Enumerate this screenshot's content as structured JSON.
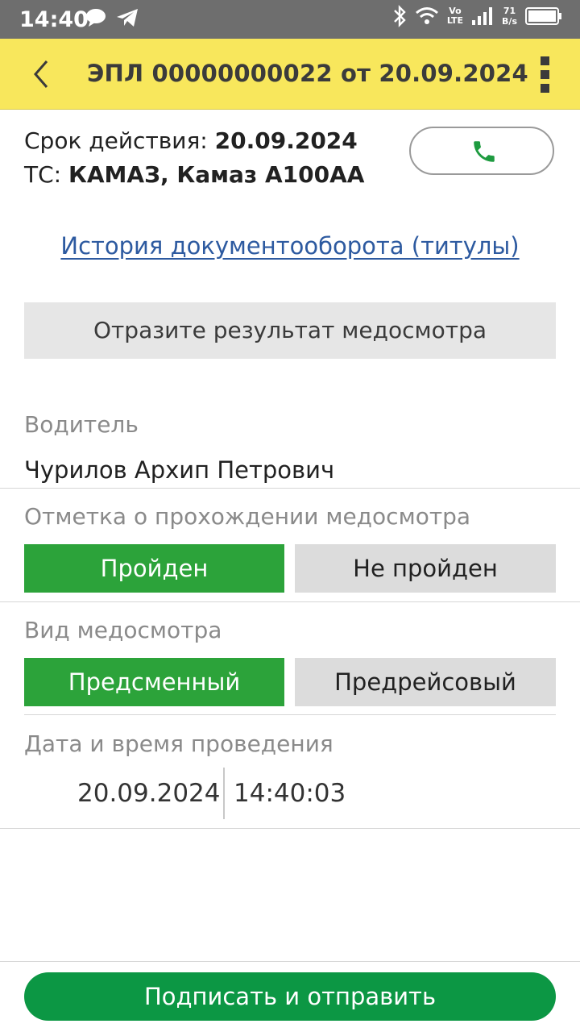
{
  "status_bar": {
    "time": "14:40",
    "network_label_top": "Vo",
    "network_label_bottom": "LTE",
    "speed_value": "71",
    "speed_unit": "B/s"
  },
  "app_bar": {
    "title": "ЭПЛ 00000000022 от 20.09.2024",
    "accent_color": "#f8e75c"
  },
  "header": {
    "validity_label": "Срок действия: ",
    "validity_value": "20.09.2024",
    "vehicle_label": "ТС: ",
    "vehicle_value": "КАМАЗ, Камаз А100АА"
  },
  "history_link": "История документооборота (титулы)",
  "result_button": "Отразите результат медосмотра",
  "driver": {
    "label": "Водитель",
    "value": "Чурилов Архип Петрович"
  },
  "medical_mark": {
    "label": "Отметка о прохождении медосмотра",
    "options": [
      "Пройден",
      "Не пройден"
    ],
    "selected": "Пройден"
  },
  "medical_type": {
    "label": "Вид медосмотра",
    "options": [
      "Предсменный",
      "Предрейсовый"
    ],
    "selected": "Предсменный"
  },
  "datetime": {
    "label": "Дата и время проведения",
    "date": "20.09.2024",
    "time": "14:40:03"
  },
  "submit_button": "Подписать и отправить",
  "colors": {
    "selected_green": "#2ca33a",
    "submit_green": "#0c9744",
    "link_blue": "#2d5aa0"
  }
}
